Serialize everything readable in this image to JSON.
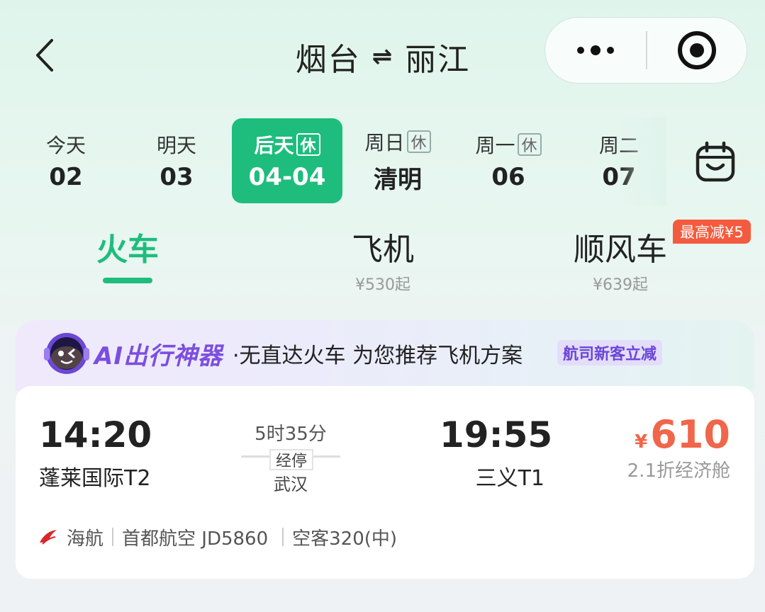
{
  "header": {
    "from": "烟台",
    "swap_symbol": "⇌",
    "to": "丽江"
  },
  "dates": [
    {
      "week": "今天",
      "day": "02",
      "tag": ""
    },
    {
      "week": "明天",
      "day": "03",
      "tag": ""
    },
    {
      "week": "后天",
      "day": "04-04",
      "tag": "休",
      "active": true
    },
    {
      "week": "周日",
      "day": "清明",
      "tag": "休"
    },
    {
      "week": "周一",
      "day": "06",
      "tag": "休"
    },
    {
      "week": "周二",
      "day": "07",
      "tag": ""
    }
  ],
  "tabs": [
    {
      "label": "火车",
      "sub": "",
      "active": true
    },
    {
      "label": "飞机",
      "sub": "¥530起"
    },
    {
      "label": "顺风车",
      "sub": "¥639起"
    }
  ],
  "promo_badge": "最高减¥5",
  "ai_banner": {
    "title": "AI出行神器",
    "text": "·无直达火车 为您推荐飞机方案",
    "tag": "航司新客立减"
  },
  "flight": {
    "dep_time": "14:20",
    "dep_airport": "蓬莱国际T2",
    "duration": "5时35分",
    "stop_label": "经停",
    "stop_city": "武汉",
    "arr_time": "19:55",
    "arr_airport": "三义T1",
    "price_currency": "¥",
    "price": "610",
    "cabin": "2.1折经济舱",
    "airline": "海航",
    "operator": "首都航空 JD5860",
    "aircraft": "空客320(中)"
  },
  "colors": {
    "accent": "#1fbd7d",
    "price": "#f0664a",
    "ai_purple": "#7b4ee0",
    "promo": "#f45b3e"
  }
}
